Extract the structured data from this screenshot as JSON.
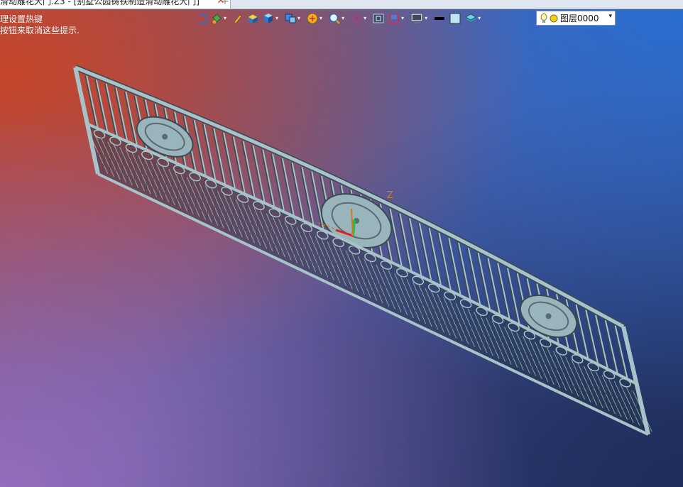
{
  "window": {
    "tab_title": "滑动雕花大门.Z3 - [别墅公园铸铁制造滑动雕花大门]",
    "tab_close": "✕",
    "new_tab": "+"
  },
  "hints": {
    "line1": "理设置热键",
    "line2": "按钮来取消这些提示."
  },
  "toolbar": {
    "dropdown_glyph": "▾",
    "buttons": [
      {
        "name": "import-icon",
        "dropdown": false
      },
      {
        "name": "paint-bucket-icon",
        "dropdown": true
      },
      {
        "name": "pen-icon",
        "dropdown": false
      },
      {
        "name": "shaded-box-icon",
        "dropdown": false
      },
      {
        "name": "cube-icon",
        "dropdown": true
      },
      {
        "name": "view-cube-icon",
        "dropdown": true
      },
      {
        "name": "render-icon",
        "dropdown": true
      },
      {
        "name": "zoom-icon",
        "dropdown": true
      },
      {
        "name": "axis-icon",
        "dropdown": true
      },
      {
        "name": "view-frame-icon",
        "dropdown": false
      },
      {
        "name": "dimension-icon",
        "dropdown": true
      },
      {
        "name": "monitor-icon",
        "dropdown": true
      },
      {
        "name": "line-style-icon",
        "dropdown": false
      },
      {
        "name": "fill-color-icon",
        "dropdown": false
      },
      {
        "name": "layer-stack-icon",
        "dropdown": true
      }
    ],
    "layer": {
      "name": "图层0000",
      "arrow": "▾"
    }
  },
  "viewport": {
    "axis_label_z": "Z",
    "colors": {
      "frame": "#a7c2c8",
      "frame_dark": "#3a4850",
      "axis_z": "#d07a20",
      "axis_x": "#e02020",
      "axis_y": "#20c040"
    }
  }
}
